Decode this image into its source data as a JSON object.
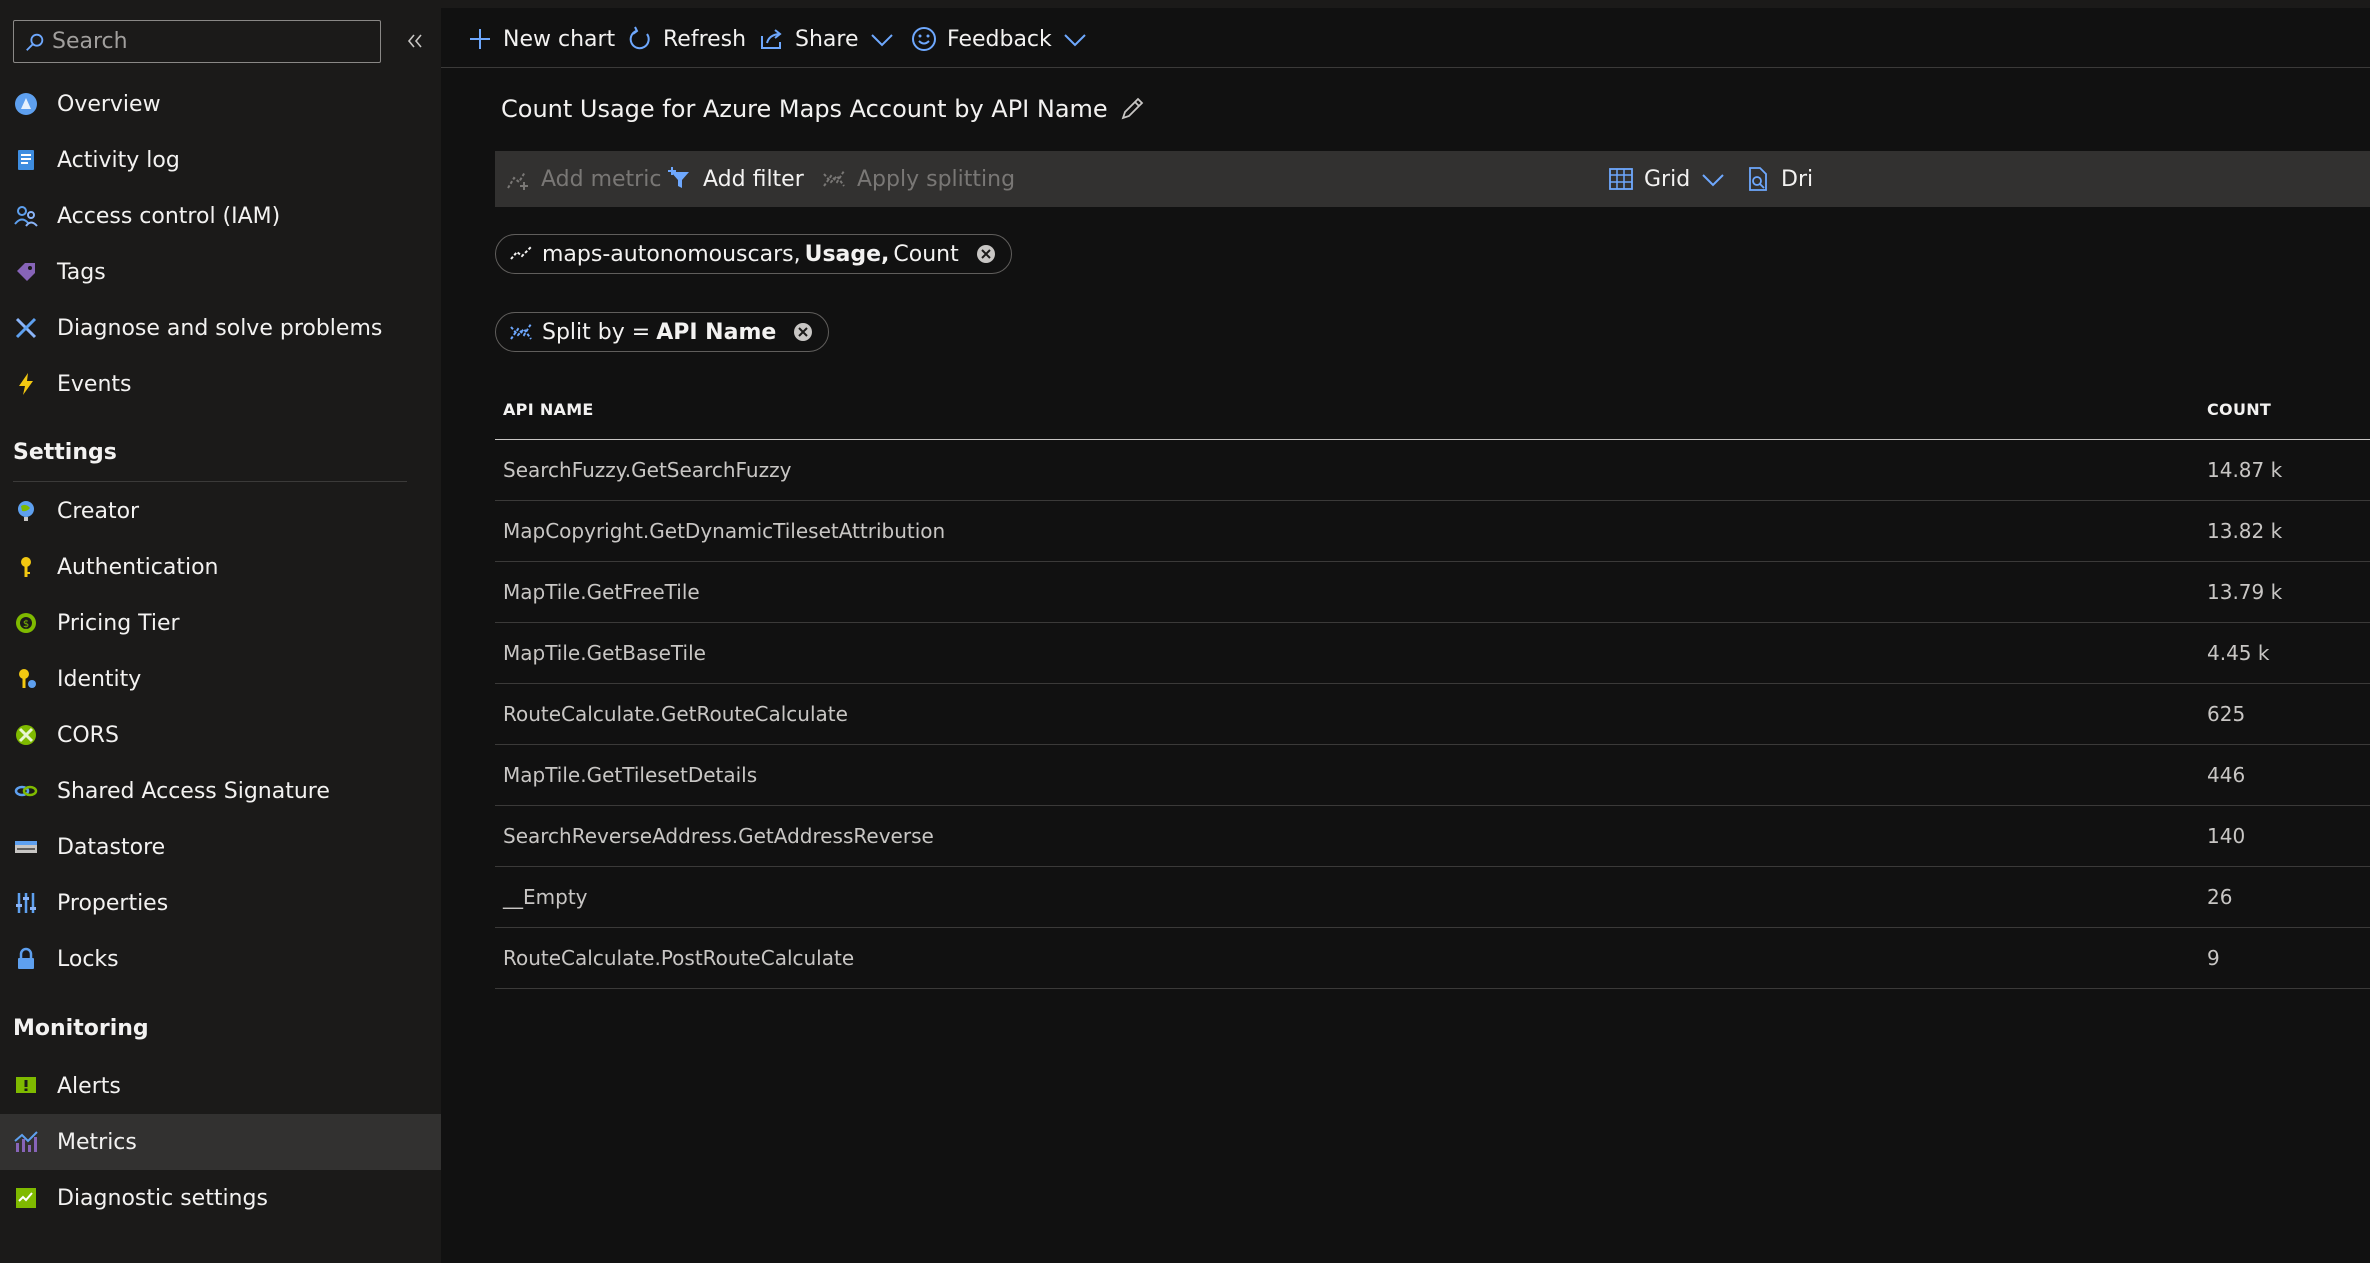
{
  "sidebar": {
    "search_placeholder": "Search",
    "items": [
      {
        "label": "Overview"
      },
      {
        "label": "Activity log"
      },
      {
        "label": "Access control (IAM)"
      },
      {
        "label": "Tags"
      },
      {
        "label": "Diagnose and solve problems"
      },
      {
        "label": "Events"
      }
    ],
    "settings_header": "Settings",
    "settings_items": [
      {
        "label": "Creator"
      },
      {
        "label": "Authentication"
      },
      {
        "label": "Pricing Tier"
      },
      {
        "label": "Identity"
      },
      {
        "label": "CORS"
      },
      {
        "label": "Shared Access Signature"
      },
      {
        "label": "Datastore"
      },
      {
        "label": "Properties"
      },
      {
        "label": "Locks"
      }
    ],
    "monitoring_header": "Monitoring",
    "monitoring_items": [
      {
        "label": "Alerts"
      },
      {
        "label": "Metrics"
      },
      {
        "label": "Diagnostic settings"
      }
    ]
  },
  "toolbar": {
    "new_chart": "New chart",
    "refresh": "Refresh",
    "share": "Share",
    "feedback": "Feedback"
  },
  "chart": {
    "title": "Count Usage for Azure Maps Account by API Name"
  },
  "cmdbar": {
    "add_metric": "Add metric",
    "add_filter": "Add filter",
    "apply_splitting": "Apply splitting",
    "grid": "Grid",
    "drill": "Dri"
  },
  "metric_pill": {
    "resource": "maps-autonomouscars,",
    "metric": "Usage,",
    "aggregation": "Count"
  },
  "split_pill": {
    "prefix": "Split by =",
    "dimension": "API Name"
  },
  "table": {
    "col_name": "API NAME",
    "col_count": "COUNT",
    "rows": [
      {
        "name": "SearchFuzzy.GetSearchFuzzy",
        "count": "14.87 k"
      },
      {
        "name": "MapCopyright.GetDynamicTilesetAttribution",
        "count": "13.82 k"
      },
      {
        "name": "MapTile.GetFreeTile",
        "count": "13.79 k"
      },
      {
        "name": "MapTile.GetBaseTile",
        "count": "4.45 k"
      },
      {
        "name": "RouteCalculate.GetRouteCalculate",
        "count": "625"
      },
      {
        "name": "MapTile.GetTilesetDetails",
        "count": "446"
      },
      {
        "name": "SearchReverseAddress.GetAddressReverse",
        "count": "140"
      },
      {
        "name": "__Empty",
        "count": "26"
      },
      {
        "name": "RouteCalculate.PostRouteCalculate",
        "count": "9"
      }
    ]
  },
  "colors": {
    "accent": "#4f6bed",
    "sidebar_bg": "#1b1a19",
    "main_bg": "#111111",
    "active_bg": "#323130"
  }
}
